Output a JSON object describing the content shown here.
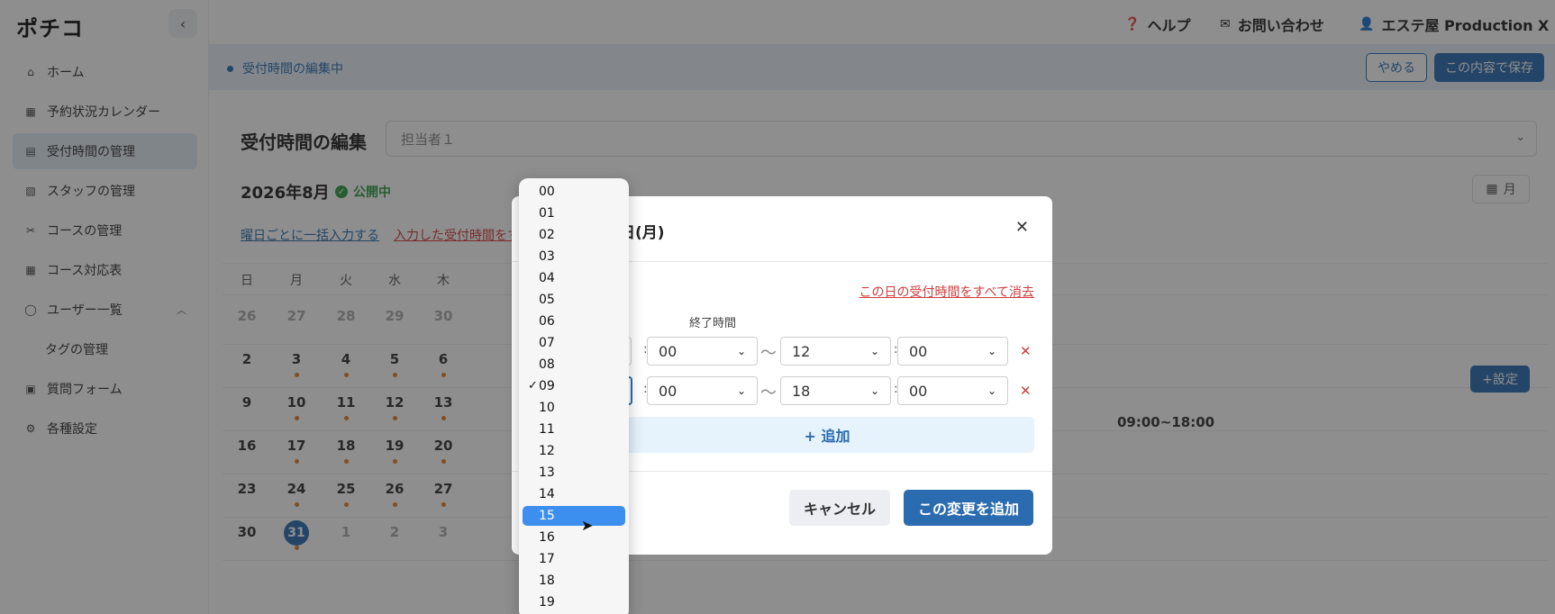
{
  "app": {
    "logo": "ポチコ",
    "collapse_icon": "chevron-left-icon"
  },
  "sidebar": {
    "items": [
      {
        "icon": "home-icon",
        "glyph": "⌂",
        "label": "ホーム"
      },
      {
        "icon": "calendar-icon",
        "glyph": "▦",
        "label": "予約状況カレンダー"
      },
      {
        "icon": "calendar-clock-icon",
        "glyph": "▤",
        "label": "受付時間の管理",
        "active": true
      },
      {
        "icon": "calendar-staff-icon",
        "glyph": "▧",
        "label": "スタッフの管理"
      },
      {
        "icon": "scissors-icon",
        "glyph": "✂",
        "label": "コースの管理"
      },
      {
        "icon": "grid-icon",
        "glyph": "▦",
        "label": "コース対応表"
      },
      {
        "icon": "user-icon",
        "glyph": "◯",
        "label": "ユーザー一覧",
        "expanded": true
      },
      {
        "icon": "",
        "glyph": "",
        "label": "タグの管理",
        "sub": true
      },
      {
        "icon": "form-icon",
        "glyph": "▣",
        "label": "質問フォーム"
      },
      {
        "icon": "gear-icon",
        "glyph": "⚙",
        "label": "各種設定"
      }
    ]
  },
  "header": {
    "help": "ヘルプ",
    "contact": "お問い合わせ",
    "account": "エステ屋 Production X"
  },
  "editbar": {
    "status": "受付時間の編集中",
    "cancel": "やめる",
    "save": "この内容で保存"
  },
  "main": {
    "title": "受付時間の編集",
    "staff_placeholder": "担当者１",
    "month": "2026年8月",
    "publish_status": "公開中",
    "view_toggle": "月",
    "link_bulk": "曜日ごとに一括入力する",
    "link_clear": "入力した受付時間をすべて消去",
    "set_button": "+設定",
    "time_summary": "09:00~18:00"
  },
  "calendar": {
    "weekdays": [
      "日",
      "月",
      "火",
      "水",
      "木"
    ],
    "weeks": [
      [
        {
          "d": "26",
          "m": true
        },
        {
          "d": "27",
          "m": true
        },
        {
          "d": "28",
          "m": true
        },
        {
          "d": "29",
          "m": true
        },
        {
          "d": "30",
          "m": true
        }
      ],
      [
        {
          "d": "2"
        },
        {
          "d": "3",
          "dot": true
        },
        {
          "d": "4",
          "dot": true
        },
        {
          "d": "5",
          "dot": true
        },
        {
          "d": "6",
          "dot": true
        }
      ],
      [
        {
          "d": "9"
        },
        {
          "d": "10",
          "dot": true
        },
        {
          "d": "11",
          "dot": true
        },
        {
          "d": "12",
          "dot": true
        },
        {
          "d": "13",
          "dot": true
        }
      ],
      [
        {
          "d": "16"
        },
        {
          "d": "17",
          "dot": true
        },
        {
          "d": "18",
          "dot": true
        },
        {
          "d": "19",
          "dot": true
        },
        {
          "d": "20",
          "dot": true
        }
      ],
      [
        {
          "d": "23"
        },
        {
          "d": "24",
          "dot": true
        },
        {
          "d": "25",
          "dot": true
        },
        {
          "d": "26",
          "dot": true
        },
        {
          "d": "27",
          "dot": true
        }
      ],
      [
        {
          "d": "30"
        },
        {
          "d": "31",
          "dot": true,
          "today": true
        },
        {
          "d": "1",
          "m": true
        },
        {
          "d": "2",
          "m": true
        },
        {
          "d": "3",
          "m": true
        }
      ]
    ]
  },
  "modal": {
    "title_suffix": "日(月)",
    "clear_day": "この日の受付時間をすべて消去",
    "end_label": "終了時間",
    "rows": [
      {
        "start_min": "00",
        "end_hour": "12",
        "end_min": "00"
      },
      {
        "start_min": "00",
        "end_hour": "18",
        "end_min": "00"
      }
    ],
    "tilde": "〜",
    "add_row": "+ 追加",
    "cancel": "キャンセル",
    "confirm": "この変更を追加"
  },
  "dropdown": {
    "options": [
      "00",
      "01",
      "02",
      "03",
      "04",
      "05",
      "06",
      "07",
      "08",
      "09",
      "10",
      "11",
      "12",
      "13",
      "14",
      "15",
      "16",
      "17",
      "18",
      "19"
    ],
    "selected": "09",
    "hovered": "15"
  },
  "colors": {
    "primary": "#2b6cb0",
    "danger": "#d23b3b",
    "success": "#2f9e44",
    "highlight": "#3d8fef",
    "dot": "#e67e22"
  }
}
